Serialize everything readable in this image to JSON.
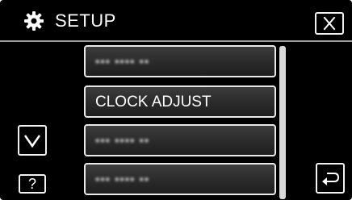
{
  "header": {
    "title": "SETUP",
    "gear_icon": "gear-icon",
    "close_icon": "close-icon"
  },
  "menu": {
    "items": [
      {
        "label": "▪▪▪ ▪▪▪▪ ▪▪",
        "blurred": true
      },
      {
        "label": "CLOCK ADJUST",
        "blurred": false
      },
      {
        "label": "▪▪▪ ▪▪▪▪ ▪▪",
        "blurred": true
      },
      {
        "label": "▪▪▪ ▪▪▪▪ ▪▪",
        "blurred": true
      }
    ]
  },
  "controls": {
    "down_icon": "chevron-down-icon",
    "help_label": "?",
    "back_icon": "return-arrow-icon"
  },
  "colors": {
    "background": "#000000",
    "border": "#e9e9e9",
    "text": "#ffffff"
  }
}
